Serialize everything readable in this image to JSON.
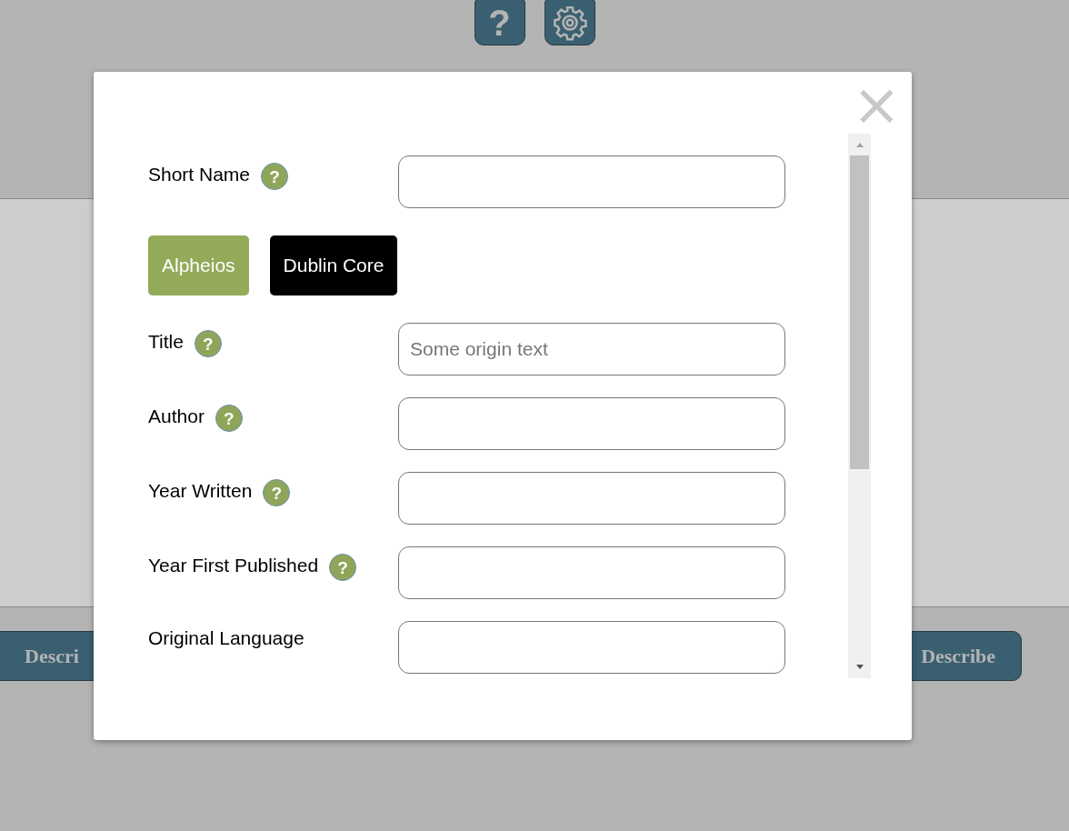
{
  "toolbar": {
    "buttons": [
      {
        "kind": "help",
        "label": "?"
      },
      {
        "kind": "settings"
      }
    ]
  },
  "footer_buttons": [
    {
      "label": "Descri"
    },
    {
      "label": "Describe"
    }
  ],
  "dialog": {
    "close": "×",
    "fields_top": [
      {
        "label": "Short Name",
        "help_label": "?"
      }
    ],
    "tabs": [
      {
        "label": "Alpheios",
        "selected": true
      },
      {
        "label": "Dublin Core",
        "selected": false
      }
    ],
    "fields": [
      {
        "label": "Title",
        "help_label": "?",
        "placeholder": "Some origin text"
      },
      {
        "label": "Author",
        "help_label": "?"
      },
      {
        "label": "Year Written",
        "help_label": "?"
      },
      {
        "label": "Year First Published",
        "help_label": "?"
      },
      {
        "label": "Original Language"
      }
    ]
  }
}
